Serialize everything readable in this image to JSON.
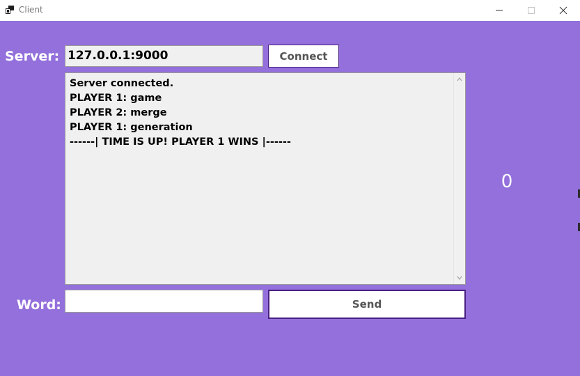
{
  "window": {
    "title": "Client",
    "icon": "app-window-icon"
  },
  "server": {
    "label": "Server:",
    "value": "127.0.0.1:9000",
    "connect_label": "Connect"
  },
  "log": {
    "lines": [
      "Server connected.",
      "PLAYER 1: game",
      "PLAYER 2: merge",
      "PLAYER 1: generation",
      "------| TIME IS UP! PLAYER 1 WINS |------"
    ]
  },
  "score": {
    "value": "0"
  },
  "word": {
    "label": "Word:",
    "value": "",
    "send_label": "Send"
  },
  "colors": {
    "background": "#9370DB",
    "button_border": "#4a1f82"
  }
}
